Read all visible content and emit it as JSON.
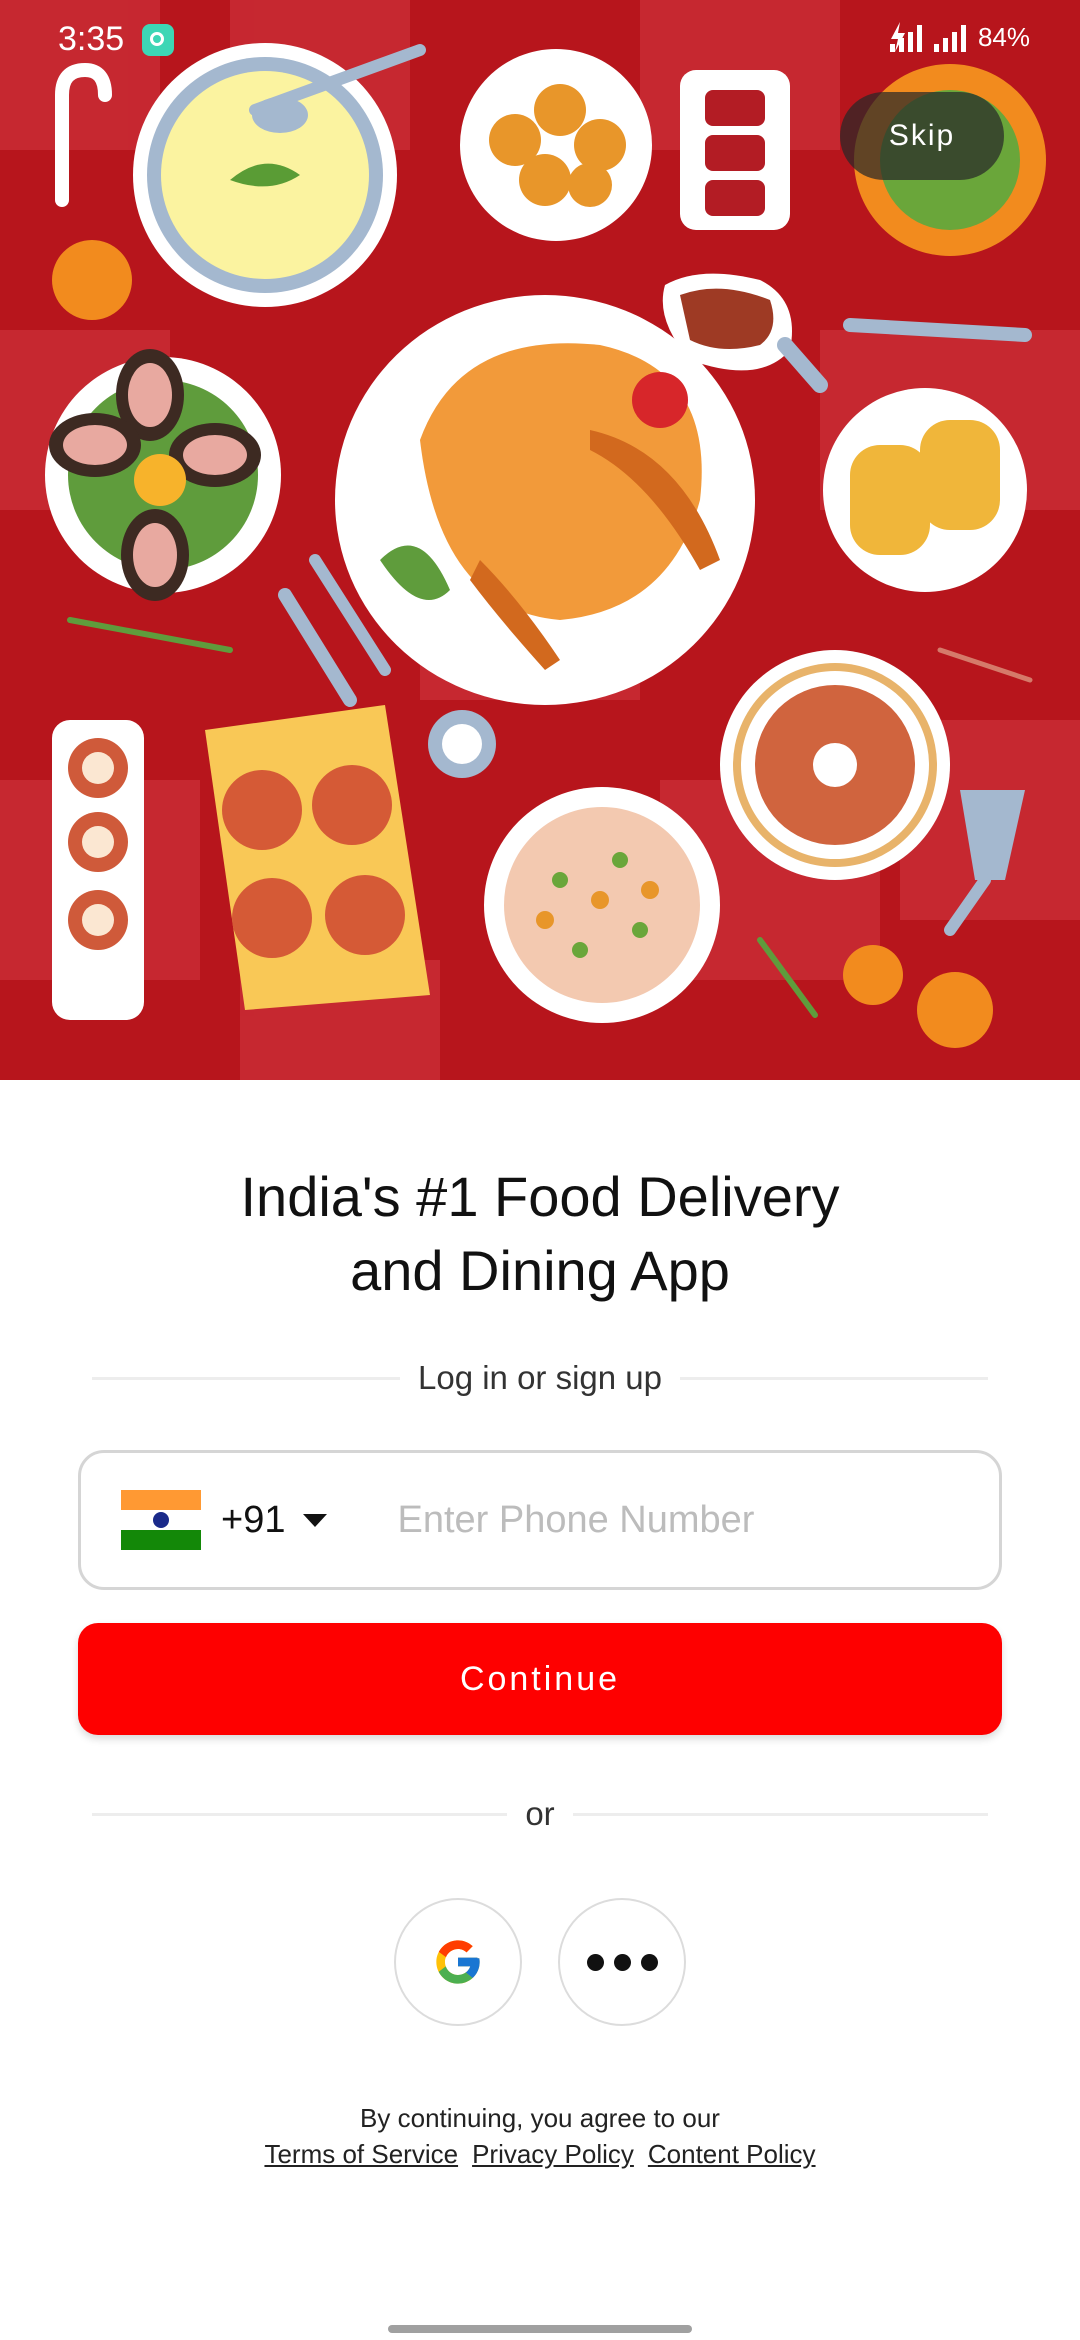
{
  "status_bar": {
    "time": "3:35",
    "battery": "84%"
  },
  "hero": {
    "skip_label": "Skip"
  },
  "headline": {
    "line1": "India's #1 Food Delivery",
    "line2": "and Dining App"
  },
  "login_divider": "Log in or sign up",
  "phone": {
    "country_code": "+91",
    "placeholder": "Enter Phone Number"
  },
  "continue_label": "Continue",
  "or_divider": "or",
  "social": {
    "google_icon": "google-icon",
    "more_icon": "more-dots-icon"
  },
  "legal": {
    "intro": "By continuing, you agree to our",
    "terms": "Terms of Service",
    "privacy": "Privacy Policy",
    "content": "Content Policy"
  },
  "colors": {
    "accent": "#fe0000",
    "hero_bg": "#b7151c"
  }
}
